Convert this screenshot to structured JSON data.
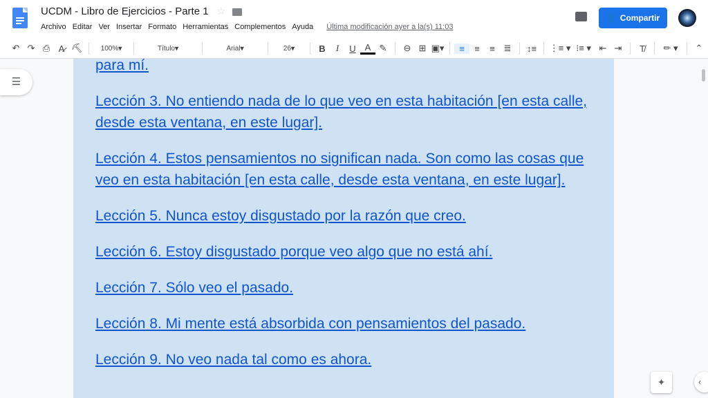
{
  "header": {
    "title": "UCDM - Libro de Ejercicios - Parte 1",
    "share_label": "Compartir",
    "menu": [
      "Archivo",
      "Editar",
      "Ver",
      "Insertar",
      "Formato",
      "Herramientas",
      "Complementos",
      "Ayuda"
    ],
    "last_modified": "Última modificación ayer a la(s) 11:03"
  },
  "toolbar": {
    "zoom": "100%",
    "style": "Título",
    "font": "Arial",
    "size": "26",
    "bold": "B",
    "italic": "I",
    "underline": "U",
    "text_color": "A",
    "text_color_value": "#000000"
  },
  "colors": {
    "page": "#cfe2f3",
    "link": "#1155cc",
    "accent": "#1a73e8"
  },
  "document": {
    "lines": [
      "para mí.",
      "Lección 3. No entiendo nada de lo que veo en esta habitación [en esta calle, desde esta ventana, en este lugar].",
      "Lección 4. Estos pensamientos no significan nada. Son como las cosas que veo en esta habitación [en esta calle, desde esta ventana, en este lugar].",
      "Lección 5. Nunca estoy disgustado por la razón que creo.",
      "Lección 6. Estoy disgustado porque veo algo que no está ahí.",
      "Lección 7. Sólo veo el pasado.",
      "Lección 8. Mi mente está absorbida con pensamientos del pasado.",
      "Lección 9. No veo nada tal como es ahora."
    ]
  }
}
